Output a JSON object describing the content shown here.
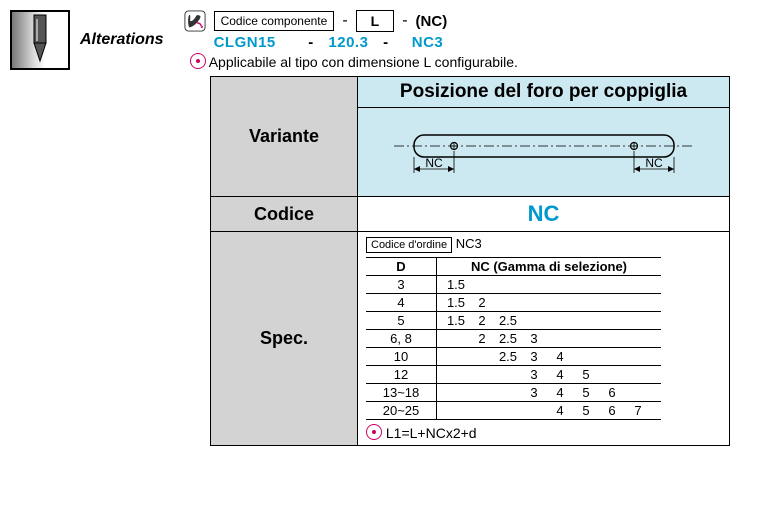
{
  "labels": {
    "alterations": "Alterations",
    "codice_componente": "Codice componente",
    "l_box": "L",
    "nc_paren": "(NC)",
    "dash": "-",
    "note_applicabile": "Applicabile al tipo con dimensione L configurabile.",
    "variante": "Variante",
    "posizione_title": "Posizione del foro per coppiglia",
    "codice": "Codice",
    "nc_code": "NC",
    "spec": "Spec.",
    "codice_ordine_label": "Codice d'ordine",
    "codice_ordine_value": "NC3",
    "d_header": "D",
    "nc_range_header": "NC (Gamma di selezione)",
    "formula": "L1=L+NCx2+d",
    "diag_nc_left": "NC",
    "diag_nc_right": "NC"
  },
  "example": {
    "code": "CLGN15",
    "l": "120.3",
    "nc": "NC3"
  },
  "chart_data": {
    "type": "table",
    "title": "NC (Gamma di selezione) vs D",
    "columns": [
      "D",
      "NC values"
    ],
    "rows": [
      {
        "d": "3",
        "values": [
          1.5
        ]
      },
      {
        "d": "4",
        "values": [
          1.5,
          2
        ]
      },
      {
        "d": "5",
        "values": [
          1.5,
          2,
          2.5
        ]
      },
      {
        "d": "6, 8",
        "values": [
          2,
          2.5,
          3
        ]
      },
      {
        "d": "10",
        "values": [
          2.5,
          3,
          4
        ]
      },
      {
        "d": "12",
        "values": [
          3,
          4,
          5
        ]
      },
      {
        "d": "13~18",
        "values": [
          3,
          4,
          5,
          6
        ]
      },
      {
        "d": "20~25",
        "values": [
          4,
          5,
          6,
          7
        ]
      }
    ],
    "nc_positions": {
      "1.5": 0,
      "2": 1,
      "2.5": 2,
      "3": 3,
      "4": 4,
      "5": 5,
      "6": 6,
      "7": 7
    }
  }
}
